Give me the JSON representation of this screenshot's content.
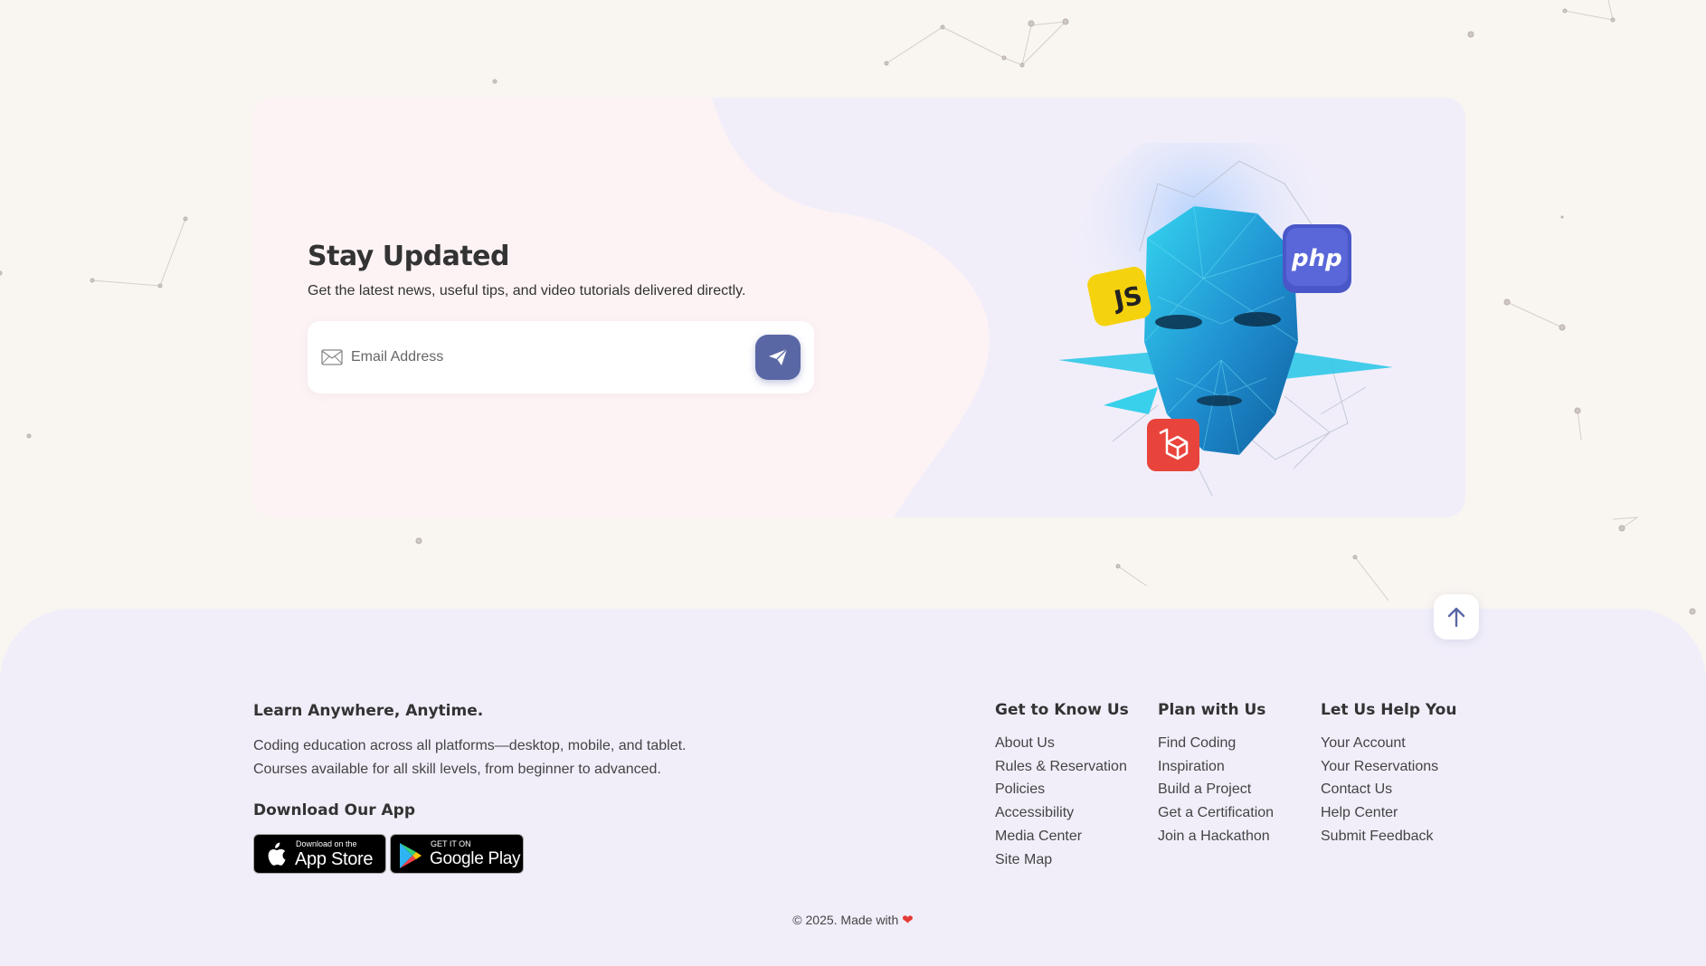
{
  "newsletter": {
    "title": "Stay Updated",
    "subtitle": "Get the latest news, useful tips, and video tutorials delivered directly.",
    "email_placeholder": "Email Address",
    "badges": {
      "js": "JS",
      "php": "php"
    }
  },
  "footer": {
    "about_title": "Learn Anywhere, Anytime.",
    "about_line1": "Coding education across all platforms—desktop, mobile, and tablet.",
    "about_line2": "Courses available for all skill levels, from beginner to advanced.",
    "app_title": "Download Our App",
    "appstore": {
      "small": "Download on the",
      "big": "App Store"
    },
    "googleplay": {
      "small": "GET IT ON",
      "big": "Google Play"
    },
    "columns": [
      {
        "title": "Get to Know Us",
        "links": [
          "About Us",
          "Rules & Reservation",
          "Policies",
          "Accessibility",
          "Media Center",
          "Site Map"
        ]
      },
      {
        "title": "Plan with Us",
        "links": [
          "Find Coding",
          "Inspiration",
          "Build a Project",
          "Get a Certification",
          "Join a Hackathon"
        ]
      },
      {
        "title": "Let Us Help You",
        "links": [
          "Your Account",
          "Your Reservations",
          "Contact Us",
          "Help Center",
          "Submit Feedback"
        ]
      }
    ],
    "copyright": "© 2025. Made with",
    "heart": "❤"
  },
  "colors": {
    "accent": "#5a67a5",
    "background": "#f9f5f1",
    "footer_bg": "#f1eefa",
    "heart": "#e53935"
  },
  "icons": {
    "email": "mail-icon",
    "send": "paper-plane-icon",
    "scroll_top": "arrow-up-icon"
  }
}
